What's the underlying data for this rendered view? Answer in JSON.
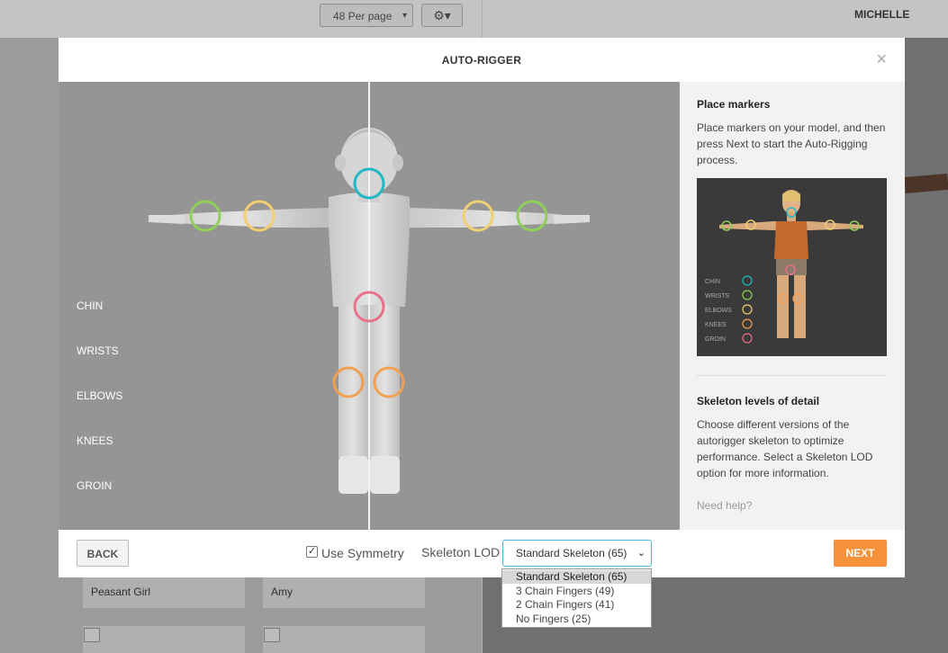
{
  "background": {
    "per_page": "48 Per page",
    "user_name": "MICHELLE",
    "cards": [
      {
        "label": "Peasant Girl"
      },
      {
        "label": "Amy"
      }
    ]
  },
  "modal": {
    "title": "AUTO-RIGGER",
    "close_glyph": "×",
    "marker_labels": [
      "CHIN",
      "WRISTS",
      "ELBOWS",
      "KNEES",
      "GROIN"
    ],
    "marker_colors": {
      "chin": "#1fb8c4",
      "wrists": "#8fcf5a",
      "elbows": "#f0d070",
      "knees": "#f0a050",
      "groin": "#e8708a"
    },
    "sidebar": {
      "place_markers_title": "Place markers",
      "place_markers_text": "Place markers on your model, and then press Next to start the Auto-Rigging process.",
      "preview_labels": [
        "CHIN",
        "WRISTS",
        "ELBOWS",
        "KNEES",
        "GROIN"
      ],
      "lod_title": "Skeleton levels of detail",
      "lod_text": "Choose different versions of the autorigger skeleton to optimize performance. Select a Skeleton LOD option for more information.",
      "help_link": "Need help?"
    },
    "footer": {
      "back_label": "BACK",
      "use_symmetry_label": "Use Symmetry",
      "use_symmetry_checked": true,
      "skeleton_lod_label": "Skeleton LOD",
      "selected_lod": "Standard Skeleton (65)",
      "lod_options": [
        "Standard Skeleton (65)",
        "3 Chain Fingers (49)",
        "2 Chain Fingers (41)",
        "No Fingers (25)"
      ],
      "next_label": "NEXT"
    }
  }
}
